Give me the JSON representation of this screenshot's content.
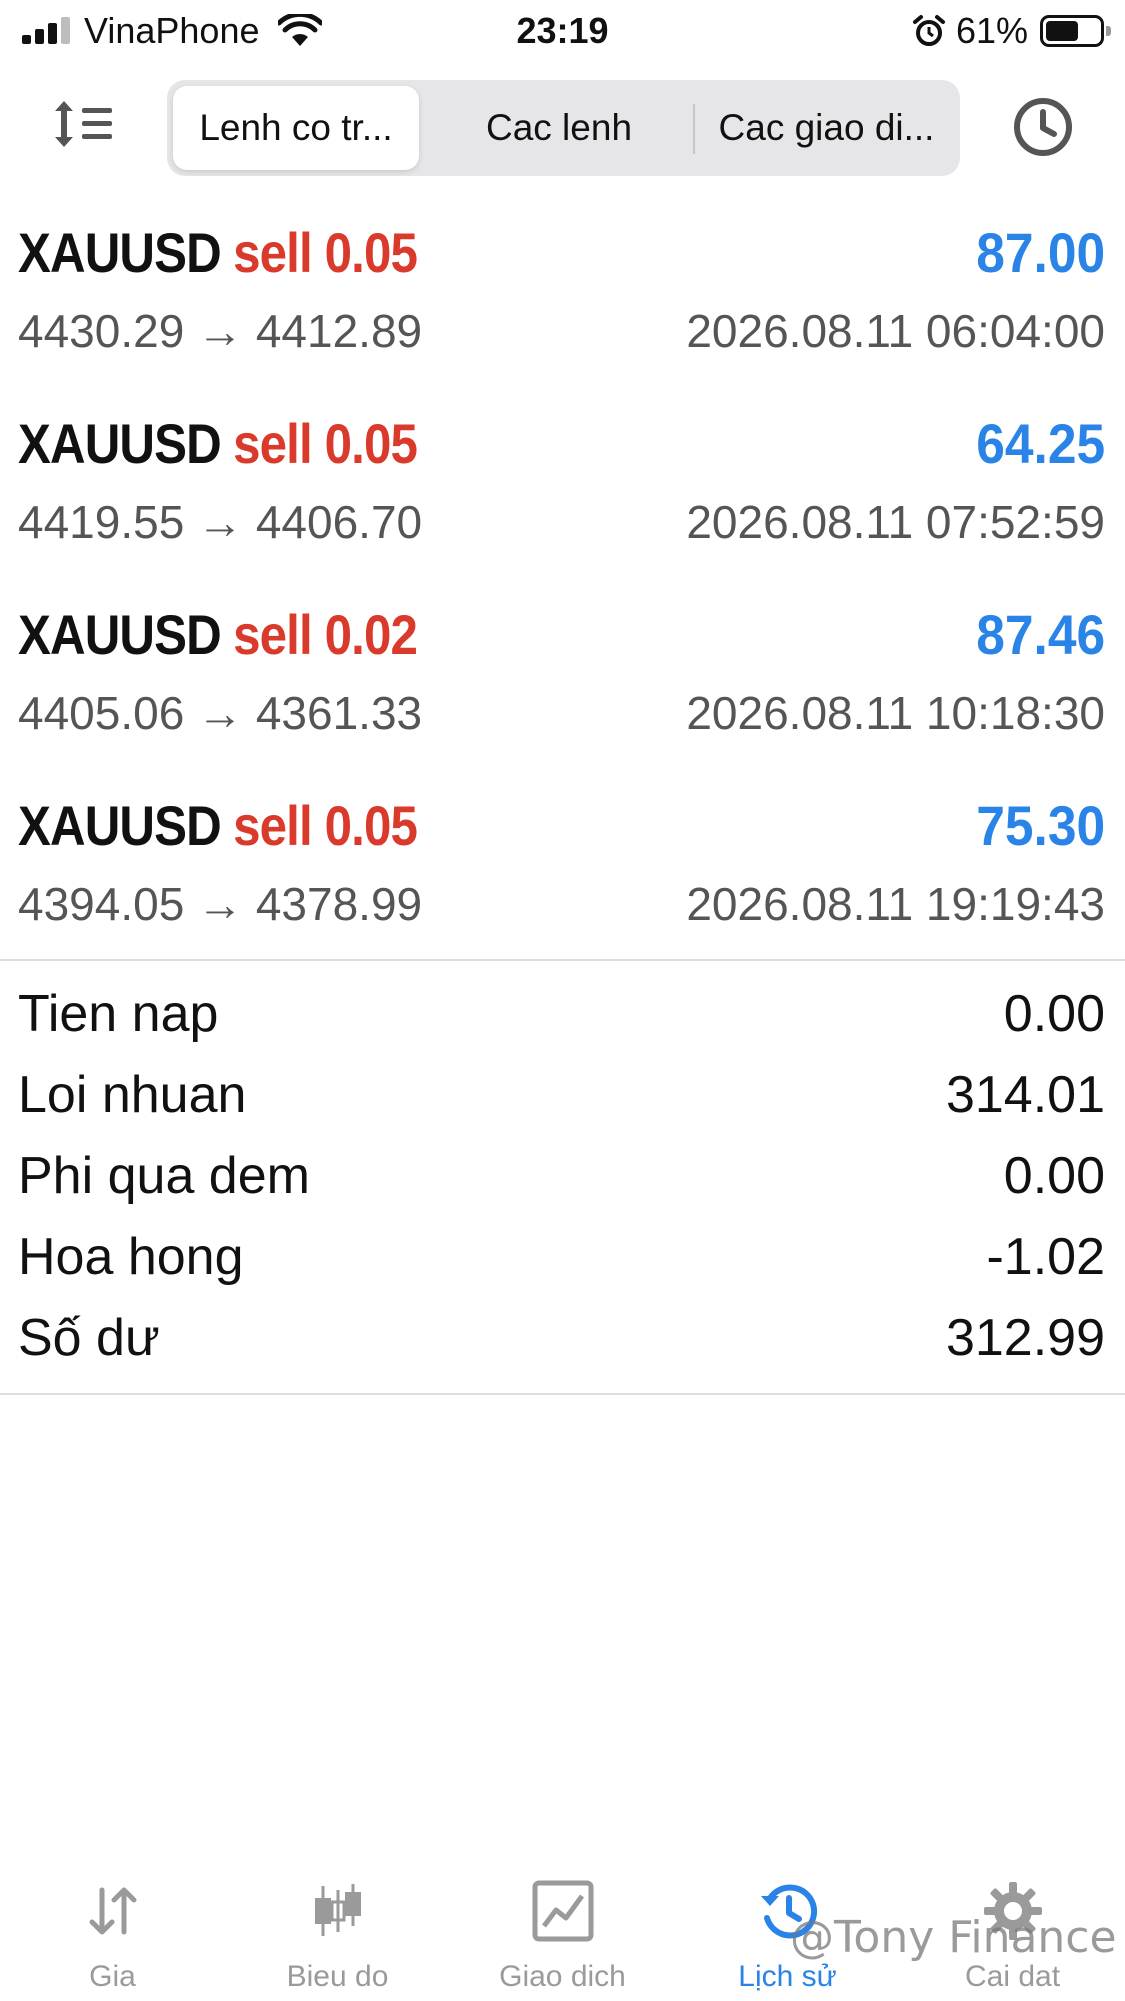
{
  "status_bar": {
    "carrier": "VinaPhone",
    "time": "23:19",
    "battery_percent": "61%",
    "battery_level": 0.61
  },
  "header": {
    "tabs": [
      {
        "label": "Lenh co tr...",
        "active": true
      },
      {
        "label": "Cac lenh",
        "active": false
      },
      {
        "label": "Cac giao di...",
        "active": false
      }
    ],
    "icons": {
      "left": "sort-icon",
      "right": "clock-icon"
    }
  },
  "trades": [
    {
      "symbol": "XAUUSD",
      "side": "sell 0.05",
      "profit": "87.00",
      "prices": "4430.29 → 4412.89",
      "time": "2026.08.11 06:04:00"
    },
    {
      "symbol": "XAUUSD",
      "side": "sell 0.05",
      "profit": "64.25",
      "prices": "4419.55 → 4406.70",
      "time": "2026.08.11 07:52:59"
    },
    {
      "symbol": "XAUUSD",
      "side": "sell 0.02",
      "profit": "87.46",
      "prices": "4405.06 → 4361.33",
      "time": "2026.08.11 10:18:30"
    },
    {
      "symbol": "XAUUSD",
      "side": "sell 0.05",
      "profit": "75.30",
      "prices": "4394.05 → 4378.99",
      "time": "2026.08.11 19:19:43"
    }
  ],
  "summary": [
    {
      "label": "Tien nap",
      "value": "0.00"
    },
    {
      "label": "Loi nhuan",
      "value": "314.01"
    },
    {
      "label": "Phi qua dem",
      "value": "0.00"
    },
    {
      "label": "Hoa hong",
      "value": "-1.02"
    },
    {
      "label": "Số dư",
      "value": "312.99"
    }
  ],
  "tabbar": [
    {
      "label": "Gia",
      "icon": "quotes-arrows-icon",
      "active": false
    },
    {
      "label": "Bieu do",
      "icon": "candlestick-chart-icon",
      "active": false
    },
    {
      "label": "Giao dich",
      "icon": "trade-chart-icon",
      "active": false
    },
    {
      "label": "Lịch sử",
      "icon": "history-icon",
      "active": true
    },
    {
      "label": "Cai dat",
      "icon": "settings-gear-icon",
      "active": false
    }
  ],
  "watermark": "@Tony Finance",
  "colors": {
    "sell": "#d93a2b",
    "profit": "#2a83e6",
    "active_tab": "#2a83e6",
    "inactive_tab": "#9a9a9a"
  }
}
